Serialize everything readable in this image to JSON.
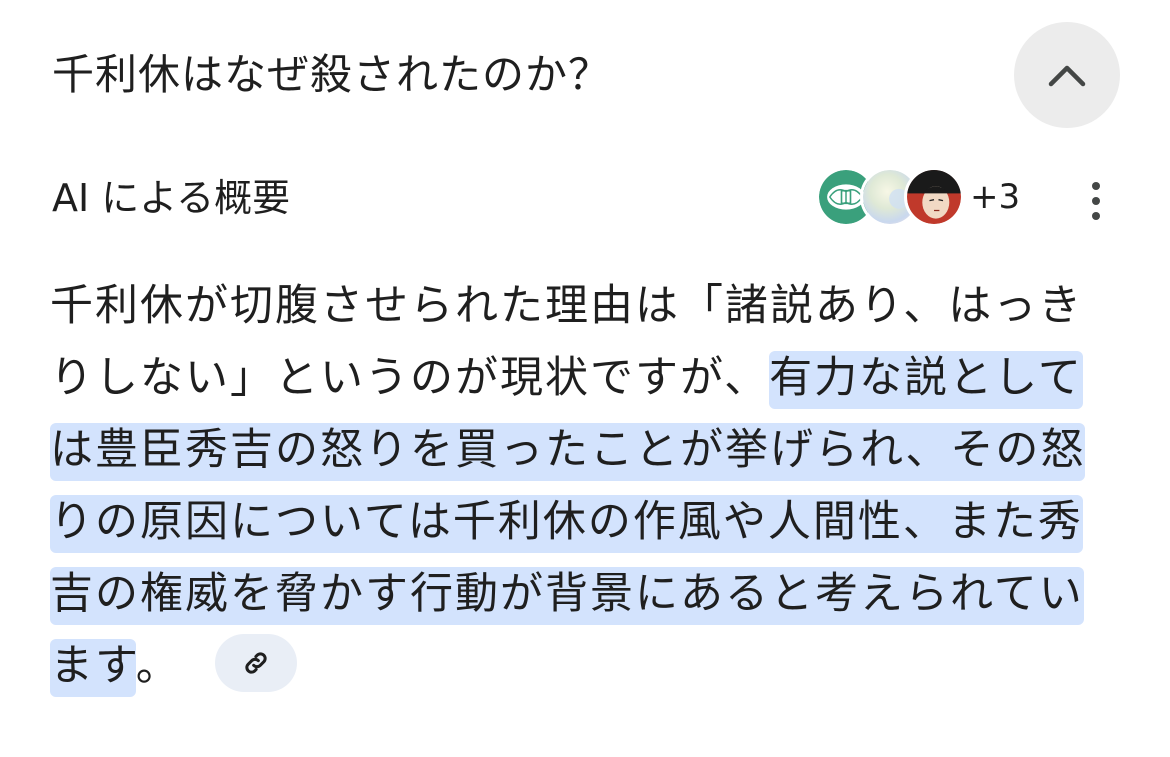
{
  "question": {
    "title": "千利休はなぜ殺されたのか？",
    "collapse_icon": "chevron-up-icon"
  },
  "overview": {
    "title": "AI による概要",
    "sources": {
      "avatars": [
        "source-logo-icon",
        "source-thumbnail",
        "source-portrait"
      ],
      "more_count": "+3"
    },
    "menu_icon": "more-vert-icon"
  },
  "answer": {
    "plain": "千利休が切腹させられた理由は「諸説あり、はっきりしない」というのが現状ですが、",
    "highlight": "有力な説としては豊臣秀吉の怒りを買ったことが挙げられ、その怒りの原因については千利休の作風や人間性、また秀吉の権威を脅かす行動が背景にあると考えられています",
    "end": "。",
    "link_icon": "link-icon"
  },
  "colors": {
    "highlight": "#d3e3fd",
    "chip_bg": "#e9eef6",
    "collapse_bg": "#ececec",
    "text": "#1f1f1f"
  }
}
